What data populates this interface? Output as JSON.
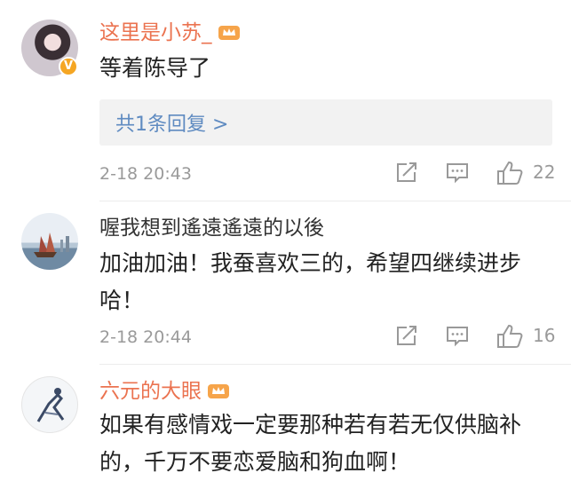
{
  "comments": [
    {
      "username": "这里是小苏_",
      "text": "等着陈导了",
      "reply_link": "共1条回复 >",
      "time": "2-18 20:43",
      "likes": "22"
    },
    {
      "username": "喔我想到遙遠遙遠的以後",
      "text_line1": "加油加油！我蚕喜欢三的，希望四继续进步",
      "text_line2": "哈！",
      "time": "2-18 20:44",
      "likes": "16"
    },
    {
      "username": "六元的大眼",
      "text_line1": "如果有感情戏一定要那种若有若无仅供脑补",
      "text_line2": "的，千万不要恋爱脑和狗血啊！"
    }
  ],
  "icons": {
    "share": "share-icon",
    "comment": "comment-icon",
    "like": "thumbs-up-icon",
    "vip": "crown-icon",
    "verified": "verified-badge-icon"
  },
  "colors": {
    "vip_name": "#eb7350",
    "link": "#5f8bc1",
    "meta": "#9a9a9a"
  }
}
